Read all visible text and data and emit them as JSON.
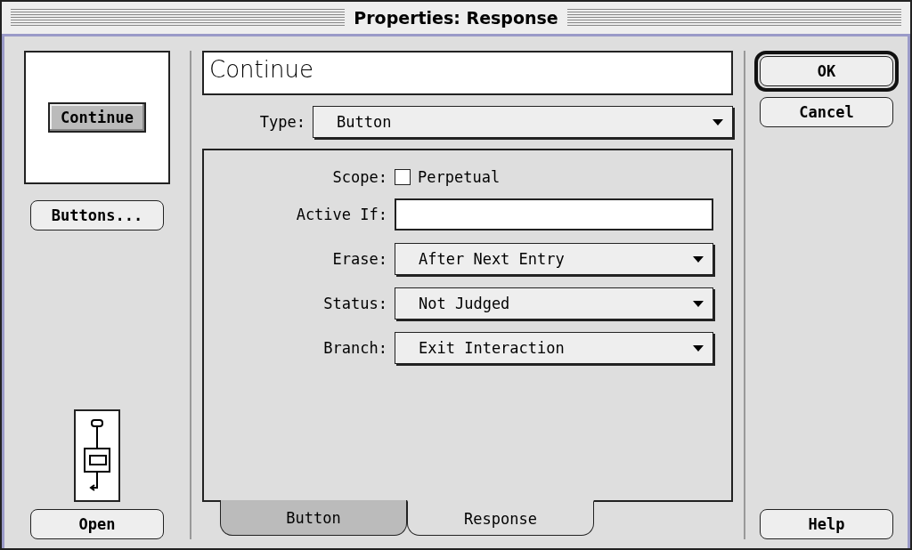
{
  "window": {
    "title": "Properties: Response"
  },
  "preview": {
    "button_label": "Continue"
  },
  "left_buttons": [
    {
      "label": "Buttons..."
    },
    {
      "label": "Open"
    }
  ],
  "name_field": {
    "value": "Continue"
  },
  "type_field": {
    "label": "Type:",
    "value": "Button"
  },
  "form": [
    {
      "kind": "checkbox",
      "label": "Scope:",
      "option": "Perpetual",
      "checked": false
    },
    {
      "kind": "text",
      "label": "Active If:"
    },
    {
      "kind": "dropdown",
      "label": "Erase:",
      "value": "After Next Entry"
    },
    {
      "kind": "dropdown",
      "label": "Status:",
      "value": "Not Judged"
    },
    {
      "kind": "dropdown",
      "label": "Branch:",
      "value": "Exit Interaction"
    }
  ],
  "tabs": [
    {
      "label": "Button",
      "selected": false
    },
    {
      "label": "Response",
      "selected": true
    }
  ],
  "right_buttons": [
    {
      "label": "OK",
      "kind": "default"
    },
    {
      "label": "Cancel",
      "kind": "normal"
    },
    {
      "label": "Help",
      "kind": "normal"
    }
  ]
}
